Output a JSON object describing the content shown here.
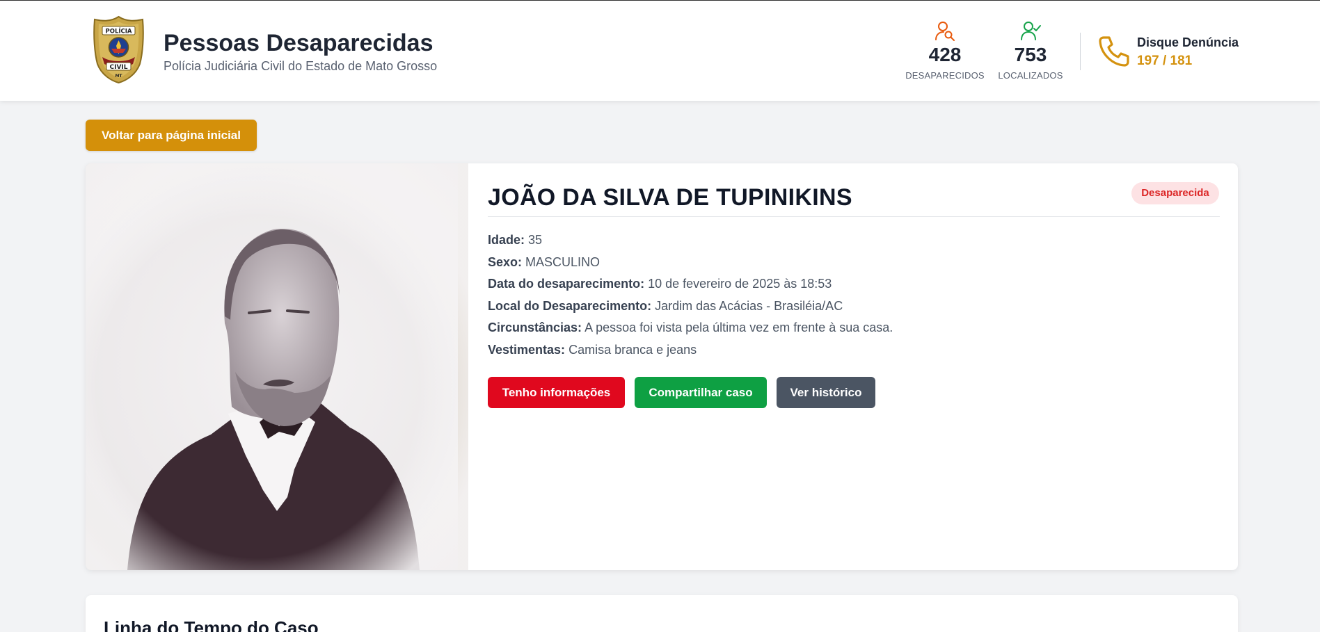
{
  "header": {
    "logo_alt": "POLÍCIA CIVIL MT",
    "title": "Pessoas Desaparecidas",
    "subtitle": "Polícia Judiciária Civil do Estado de Mato Grosso",
    "stats": {
      "missing": {
        "value": "428",
        "label": "DESAPARECIDOS",
        "icon": "user-search-icon",
        "color": "#e8590c"
      },
      "found": {
        "value": "753",
        "label": "LOCALIZADOS",
        "icon": "user-check-icon",
        "color": "#16a34a"
      }
    },
    "hotline": {
      "title": "Disque Denúncia",
      "number": "197 / 181",
      "icon": "phone-icon",
      "color": "#d4920f"
    }
  },
  "back_button": {
    "label": "Voltar para página inicial"
  },
  "person": {
    "name": "JOÃO DA SILVA DE TUPINIKINS",
    "status": "Desaparecida",
    "details": [
      {
        "key": "Idade:",
        "value": "35"
      },
      {
        "key": "Sexo:",
        "value": "MASCULINO"
      },
      {
        "key": "Data do desaparecimento:",
        "value": "10 de fevereiro de 2025 às 18:53"
      },
      {
        "key": "Local do Desaparecimento:",
        "value": "Jardim das Acácias - Brasiléia/AC"
      },
      {
        "key": "Circunstâncias:",
        "value": "A pessoa foi vista pela última vez em frente à sua casa."
      },
      {
        "key": "Vestimentas:",
        "value": "Camisa branca e jeans"
      }
    ],
    "actions": {
      "info": "Tenho informações",
      "share": "Compartilhar caso",
      "history": "Ver histórico"
    }
  },
  "timeline": {
    "title": "Linha do Tempo do Caso"
  },
  "colors": {
    "accent": "#d4900a",
    "danger": "#e0081e",
    "success": "#0ea043",
    "neutral": "#4b5563"
  }
}
